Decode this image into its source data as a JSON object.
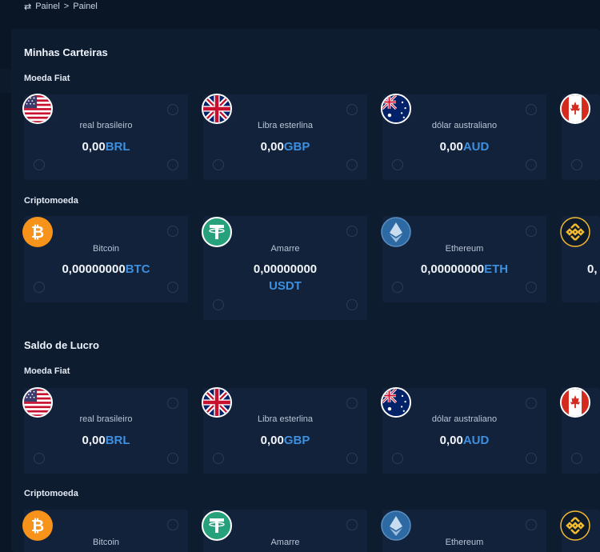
{
  "breadcrumb": {
    "switch_icon": "⇄",
    "items": [
      "Painel",
      "Painel"
    ],
    "separator": ">"
  },
  "section_wallets": {
    "title": "Minhas Carteiras",
    "fiat_title": "Moeda Fiat",
    "crypto_title": "Criptomoeda",
    "fiat": [
      {
        "flag": "us-flag-icon",
        "name": "real brasileiro",
        "amount": "0,00",
        "currency": "BRL"
      },
      {
        "flag": "uk-flag-icon",
        "name": "Libra esterlina",
        "amount": "0,00",
        "currency": "GBP"
      },
      {
        "flag": "australia-flag-icon",
        "name": "dólar australiano",
        "amount": "0,00",
        "currency": "AUD"
      },
      {
        "flag": "canada-flag-icon",
        "name": "",
        "amount": "",
        "currency": ""
      }
    ],
    "crypto": [
      {
        "icon": "bitcoin-icon",
        "name": "Bitcoin",
        "amount": "0,00000000",
        "currency": "BTC"
      },
      {
        "icon": "tether-icon",
        "name": "Amarre",
        "amount": "0,00000000",
        "currency": "USDT"
      },
      {
        "icon": "ethereum-icon",
        "name": "Ethereum",
        "amount": "0,00000000",
        "currency": "ETH"
      },
      {
        "icon": "binance-icon",
        "name": "",
        "amount": "0,",
        "currency": ""
      }
    ]
  },
  "section_profit": {
    "title": "Saldo de Lucro",
    "fiat_title": "Moeda Fiat",
    "crypto_title": "Criptomoeda",
    "fiat": [
      {
        "flag": "us-flag-icon",
        "name": "real brasileiro",
        "amount": "0,00",
        "currency": "BRL"
      },
      {
        "flag": "uk-flag-icon",
        "name": "Libra esterlina",
        "amount": "0,00",
        "currency": "GBP"
      },
      {
        "flag": "australia-flag-icon",
        "name": "dólar australiano",
        "amount": "0,00",
        "currency": "AUD"
      },
      {
        "flag": "canada-flag-icon",
        "name": "",
        "amount": "",
        "currency": ""
      }
    ],
    "crypto": [
      {
        "icon": "bitcoin-icon",
        "name": "Bitcoin"
      },
      {
        "icon": "tether-icon",
        "name": "Amarre"
      },
      {
        "icon": "ethereum-icon",
        "name": "Ethereum"
      },
      {
        "icon": "binance-icon",
        "name": ""
      }
    ]
  },
  "colors": {
    "background": "#0a1526",
    "panel": "#0e1c30",
    "card": "#12223a",
    "accent": "#3d8fe0",
    "bitcoin": "#f7931a",
    "tether": "#26a17b",
    "binance": "#f3ba2f"
  }
}
